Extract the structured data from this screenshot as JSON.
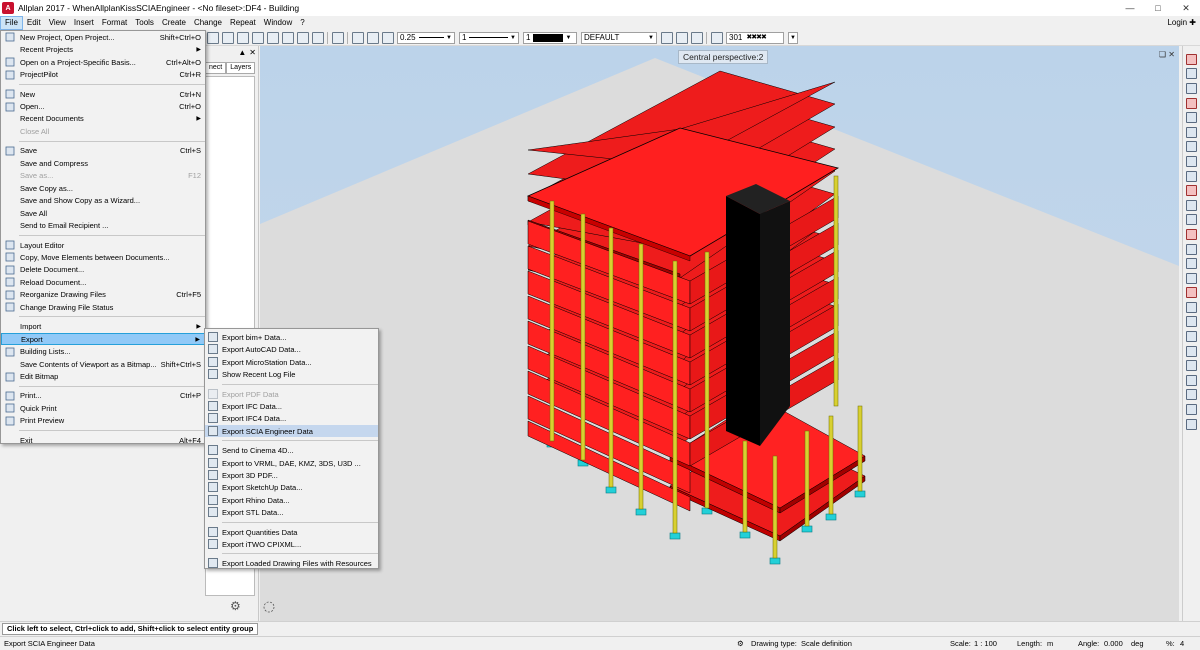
{
  "window": {
    "title": "Allplan 2017 - WhenAllplanKissSCIAEngineer - <No fileset>:DF4 - Building",
    "icon": "A"
  },
  "menubar": {
    "items": [
      "File",
      "Edit",
      "View",
      "Insert",
      "Format",
      "Tools",
      "Create",
      "Change",
      "Repeat",
      "Window",
      "?"
    ],
    "login": "Login"
  },
  "toolbar": {
    "pen_thickness": "0.25",
    "line_type": "1",
    "color_number": "1",
    "layer": "DEFAULT",
    "hatch_number": "301"
  },
  "left_panel": {
    "tabs": [
      "nect",
      "Layers"
    ]
  },
  "file_menu": {
    "items": [
      {
        "label": "New Project, Open Project...",
        "shortcut": "Shift+Ctrl+O",
        "icon": "folder-icon"
      },
      {
        "label": "Recent Projects",
        "submenu": true
      },
      {
        "label": "Open on a Project-Specific Basis...",
        "shortcut": "Ctrl+Alt+O",
        "icon": "open-folder-icon"
      },
      {
        "label": "ProjectPilot",
        "shortcut": "Ctrl+R",
        "icon": "projectpilot-icon"
      },
      {
        "separator": true
      },
      {
        "label": "New",
        "shortcut": "Ctrl+N",
        "icon": "new-file-icon"
      },
      {
        "label": "Open...",
        "shortcut": "Ctrl+O",
        "icon": "open-icon"
      },
      {
        "label": "Recent Documents",
        "submenu": true
      },
      {
        "label": "Close All",
        "disabled": true
      },
      {
        "separator": true
      },
      {
        "label": "Save",
        "shortcut": "Ctrl+S",
        "icon": "save-icon"
      },
      {
        "label": "Save and Compress"
      },
      {
        "label": "Save as...",
        "shortcut": "F12",
        "disabled": true
      },
      {
        "label": "Save Copy as..."
      },
      {
        "label": "Save and Show Copy as a Wizard..."
      },
      {
        "label": "Save All"
      },
      {
        "label": "Send to Email Recipient ..."
      },
      {
        "separator": true
      },
      {
        "label": "Layout Editor",
        "icon": "layout-editor-icon"
      },
      {
        "label": "Copy, Move Elements between Documents...",
        "icon": "copy-move-icon"
      },
      {
        "label": "Delete Document...",
        "icon": "delete-document-icon"
      },
      {
        "label": "Reload Document...",
        "icon": "reload-icon"
      },
      {
        "label": "Reorganize Drawing Files",
        "shortcut": "Ctrl+F5",
        "icon": "reorganize-icon"
      },
      {
        "label": "Change Drawing File Status",
        "icon": "file-status-icon"
      },
      {
        "separator": true
      },
      {
        "label": "Import",
        "submenu": true
      },
      {
        "label": "Export",
        "submenu": true,
        "highlight": true
      },
      {
        "label": "Building Lists...",
        "icon": "building-lists-icon"
      },
      {
        "label": "Save Contents of Viewport as a Bitmap...",
        "shortcut": "Shift+Ctrl+S"
      },
      {
        "label": "Edit Bitmap",
        "icon": "edit-bitmap-icon"
      },
      {
        "separator": true
      },
      {
        "label": "Print...",
        "shortcut": "Ctrl+P",
        "icon": "print-icon"
      },
      {
        "label": "Quick Print",
        "icon": "quick-print-icon"
      },
      {
        "label": "Print Preview",
        "icon": "print-preview-icon"
      },
      {
        "separator": true
      },
      {
        "label": "Exit",
        "shortcut": "Alt+F4"
      }
    ]
  },
  "export_submenu": {
    "items": [
      {
        "label": "Export bim+ Data..."
      },
      {
        "label": "Export AutoCAD Data..."
      },
      {
        "label": "Export MicroStation Data..."
      },
      {
        "label": "Show Recent Log File"
      },
      {
        "separator": true
      },
      {
        "label": "Export PDF Data",
        "disabled": true
      },
      {
        "label": "Export IFC Data..."
      },
      {
        "label": "Export IFC4 Data..."
      },
      {
        "label": "Export SCIA Engineer Data",
        "highlight": true
      },
      {
        "separator": true
      },
      {
        "label": "Send to Cinema 4D..."
      },
      {
        "label": "Export to VRML, DAE, KMZ, 3DS, U3D ..."
      },
      {
        "label": "Export 3D PDF..."
      },
      {
        "label": "Export SketchUp Data..."
      },
      {
        "label": "Export Rhino Data..."
      },
      {
        "label": "Export STL Data..."
      },
      {
        "separator": true
      },
      {
        "label": "Export Quantities Data"
      },
      {
        "label": "Export iTWO CPIXML..."
      },
      {
        "separator": true
      },
      {
        "label": "Export Loaded Drawing Files with Resources"
      }
    ]
  },
  "viewport": {
    "label": "Central perspective:2"
  },
  "status": {
    "prompt": "Click left to select, Ctrl+click to add, Shift+click to select entity group",
    "hint": "Export SCIA Engineer Data",
    "drawing_type_label": "Drawing type:",
    "drawing_type_value": "Scale definition",
    "scale_label": "Scale:",
    "scale_value": "1 : 100",
    "length_label": "Length:",
    "length_value": "m",
    "angle_label": "Angle:",
    "angle_value": "0.000",
    "angle_unit": "deg",
    "zoom_label": "%:",
    "zoom_value": "4"
  }
}
